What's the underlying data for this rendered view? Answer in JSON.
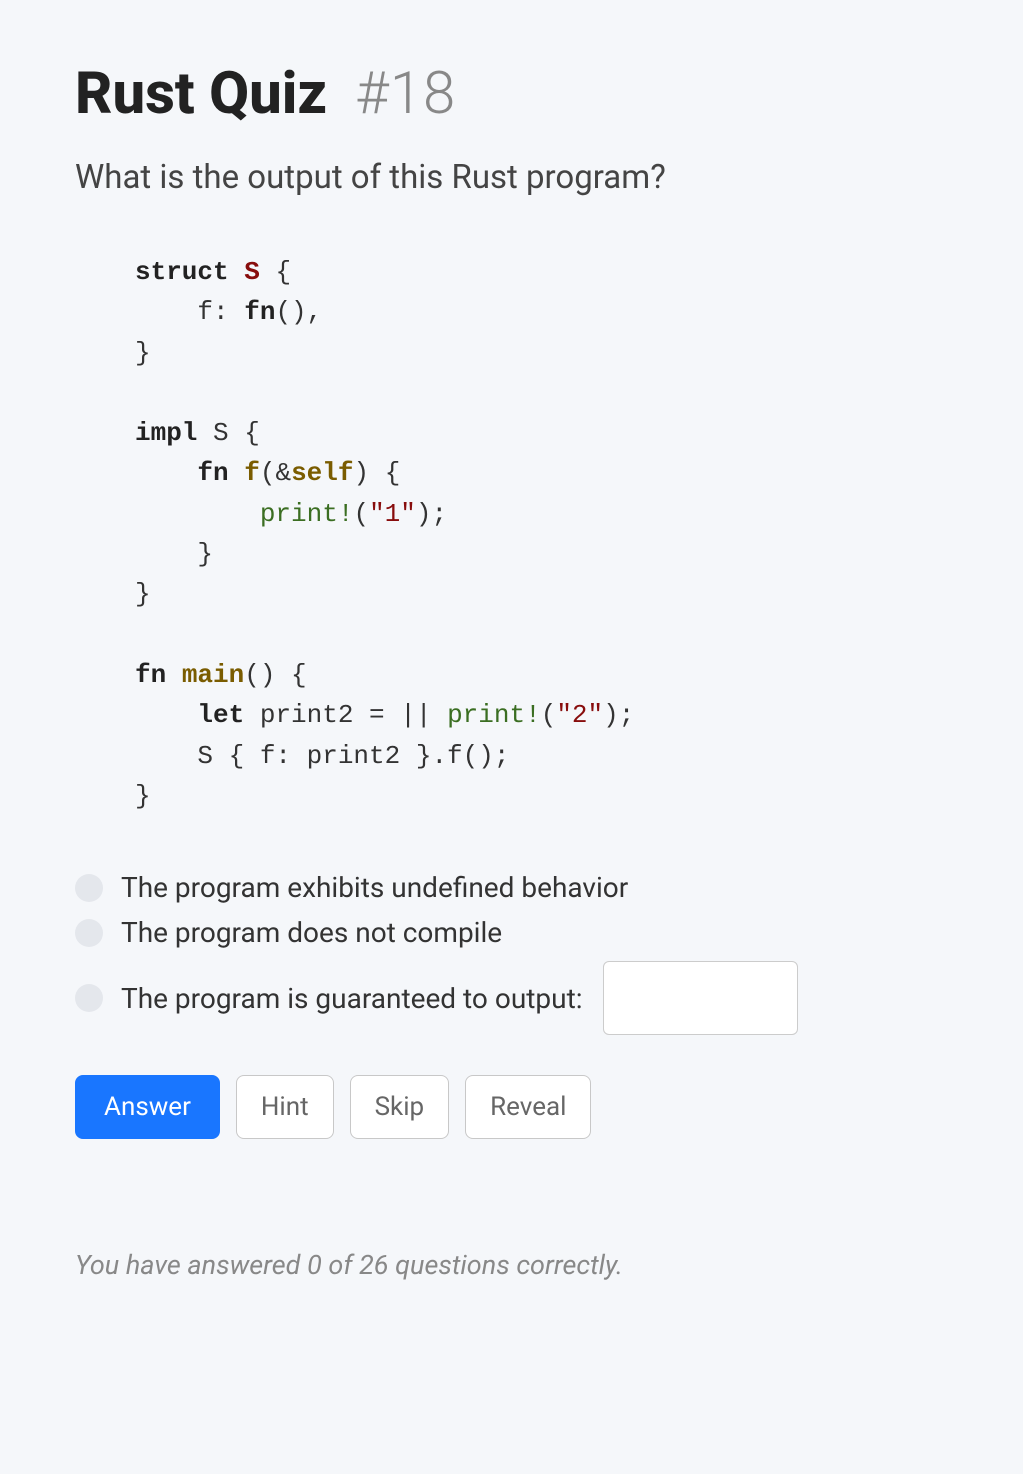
{
  "header": {
    "title": "Rust Quiz",
    "number": "#18"
  },
  "question": "What is the output of this Rust program?",
  "options": {
    "undefined_behavior": "The program exhibits undefined behavior",
    "not_compile": "The program does not compile",
    "guaranteed_output": "The program is guaranteed to output:"
  },
  "buttons": {
    "answer": "Answer",
    "hint": "Hint",
    "skip": "Skip",
    "reveal": "Reveal"
  },
  "score": "You have answered 0 of 26 questions correctly."
}
